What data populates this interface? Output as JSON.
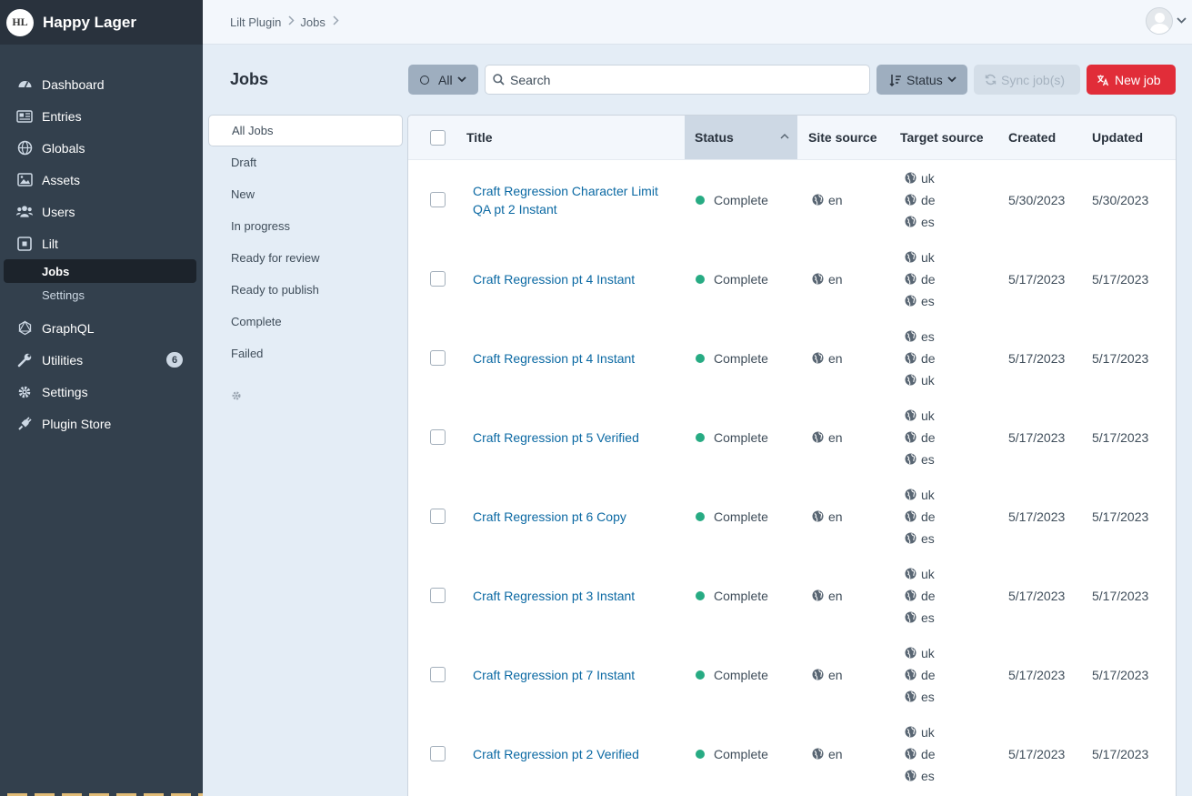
{
  "sidebar": {
    "logo_text": "HL",
    "site_name": "Happy Lager",
    "items": [
      {
        "label": "Dashboard",
        "icon": "dashboard-gauge-icon"
      },
      {
        "label": "Entries",
        "icon": "newspaper-icon"
      },
      {
        "label": "Globals",
        "icon": "globe-icon"
      },
      {
        "label": "Assets",
        "icon": "image-icon"
      },
      {
        "label": "Users",
        "icon": "users-icon"
      },
      {
        "label": "Lilt",
        "icon": "lilt-icon"
      },
      {
        "label": "GraphQL",
        "icon": "graphql-icon"
      },
      {
        "label": "Utilities",
        "icon": "wrench-icon",
        "badge": "6"
      },
      {
        "label": "Settings",
        "icon": "gear-icon"
      },
      {
        "label": "Plugin Store",
        "icon": "plug-icon"
      }
    ],
    "lilt_subnav": [
      {
        "label": "Jobs",
        "active": true
      },
      {
        "label": "Settings",
        "active": false
      }
    ]
  },
  "header": {
    "breadcrumbs": [
      "Lilt Plugin",
      "Jobs"
    ]
  },
  "page": {
    "title": "Jobs"
  },
  "toolbar": {
    "filter_label": "All",
    "search_placeholder": "Search",
    "sort_label": "Status",
    "sync_label": "Sync job(s)",
    "new_job_label": "New job"
  },
  "sources": {
    "items": [
      "All Jobs",
      "Draft",
      "New",
      "In progress",
      "Ready for review",
      "Ready to publish",
      "Complete",
      "Failed"
    ],
    "selected_index": 0
  },
  "table": {
    "columns": {
      "title": "Title",
      "status": "Status",
      "site_source": "Site source",
      "target_source": "Target source",
      "created": "Created",
      "updated": "Updated"
    },
    "sorted_column": "status",
    "rows": [
      {
        "title": "Craft Regression Character Limit QA pt 2 Instant",
        "status": "Complete",
        "source": "en",
        "targets": [
          "uk",
          "de",
          "es"
        ],
        "created": "5/30/2023",
        "updated": "5/30/2023"
      },
      {
        "title": "Craft Regression pt 4 Instant",
        "status": "Complete",
        "source": "en",
        "targets": [
          "uk",
          "de",
          "es"
        ],
        "created": "5/17/2023",
        "updated": "5/17/2023"
      },
      {
        "title": "Craft Regression pt 4 Instant",
        "status": "Complete",
        "source": "en",
        "targets": [
          "es",
          "de",
          "uk"
        ],
        "created": "5/17/2023",
        "updated": "5/17/2023"
      },
      {
        "title": "Craft Regression pt 5 Verified",
        "status": "Complete",
        "source": "en",
        "targets": [
          "uk",
          "de",
          "es"
        ],
        "created": "5/17/2023",
        "updated": "5/17/2023"
      },
      {
        "title": "Craft Regression pt 6 Copy",
        "status": "Complete",
        "source": "en",
        "targets": [
          "uk",
          "de",
          "es"
        ],
        "created": "5/17/2023",
        "updated": "5/17/2023"
      },
      {
        "title": "Craft Regression pt 3 Instant",
        "status": "Complete",
        "source": "en",
        "targets": [
          "uk",
          "de",
          "es"
        ],
        "created": "5/17/2023",
        "updated": "5/17/2023"
      },
      {
        "title": "Craft Regression pt 7 Instant",
        "status": "Complete",
        "source": "en",
        "targets": [
          "uk",
          "de",
          "es"
        ],
        "created": "5/17/2023",
        "updated": "5/17/2023"
      },
      {
        "title": "Craft Regression pt 2 Verified",
        "status": "Complete",
        "source": "en",
        "targets": [
          "uk",
          "de",
          "es"
        ],
        "created": "5/17/2023",
        "updated": "5/17/2023"
      }
    ]
  },
  "colors": {
    "sidebar_bg": "#33404d",
    "accent_red": "#e12d39",
    "link_blue": "#0b69a3",
    "status_complete": "#27ab83"
  }
}
